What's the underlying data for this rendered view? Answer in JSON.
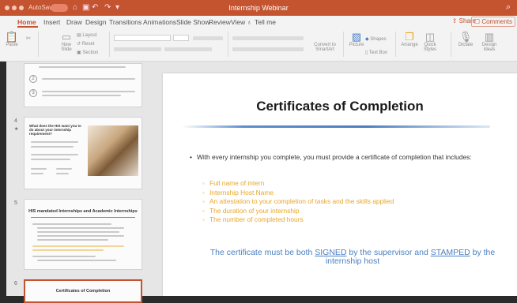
{
  "titlebar": {
    "autosave_label": "AutoSave",
    "toggle_state": "OFF",
    "document_title": "Internship Webinar"
  },
  "tabs": [
    "Home",
    "Insert",
    "Draw",
    "Design",
    "Transitions",
    "Animations",
    "Slide Show",
    "Review",
    "View"
  ],
  "tell_me": "Tell me",
  "share_label": "Share",
  "comments_label": "Comments",
  "toolbar": {
    "paste": "Paste",
    "new_slide": "New Slide",
    "layout": "Layout",
    "reset": "Reset",
    "section": "Section",
    "convert": "Convert to SmartArt",
    "picture": "Picture",
    "text_box": "Text Box",
    "shapes": "Shapes",
    "arrange": "Arrange",
    "quick_styles": "Quick Styles",
    "dictate": "Dictate",
    "design_ideas": "Design Ideas"
  },
  "thumbnails": {
    "slide4": {
      "number": "4",
      "title": "What does the HIS want you to do about your internship requirement?"
    },
    "slide5": {
      "number": "5",
      "title": "HIS mandated Internships and Academic Internships"
    },
    "slide6": {
      "number": "6",
      "title": "Certificates of Completion"
    }
  },
  "slide": {
    "title": "Certificates of Completion",
    "main_bullet": "With every internship you complete, you must provide a certificate of completion that includes:",
    "sub_items": [
      "Full name of intern",
      "Internship Host Name",
      "An attestation to your completion of tasks and the skills applied",
      "The duration of your internship",
      "The number of completed hours"
    ],
    "note_before_signed": "The certificate must be both ",
    "note_signed": "SIGNED",
    "note_middle": " by the supervisor and ",
    "note_stamped": "STAMPED",
    "note_after": " by the internship host"
  },
  "colors": {
    "accent": "#c4532f",
    "bullet_yellow": "#e8a628",
    "note_blue": "#4a7fc2"
  }
}
